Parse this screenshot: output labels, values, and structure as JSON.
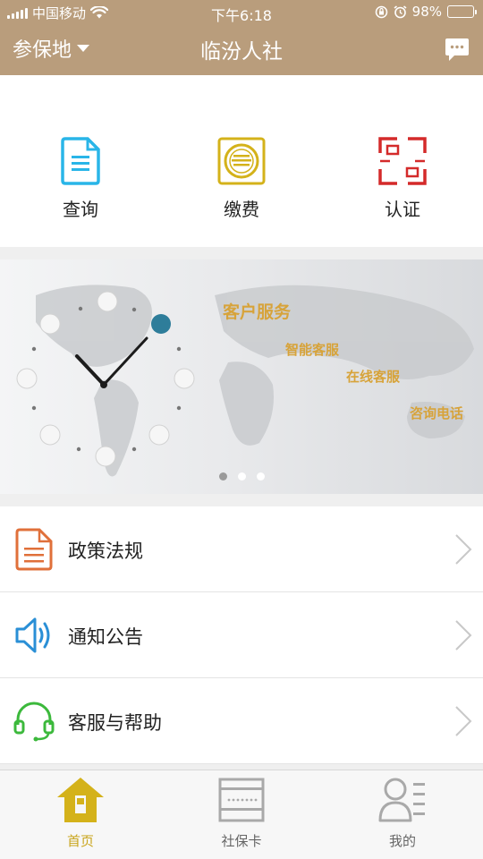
{
  "status_bar": {
    "carrier": "中国移动",
    "time": "下午6:18",
    "battery_text": "98%",
    "battery_level": 0.98,
    "icons": [
      "signal-icon",
      "wifi-icon",
      "orientation-lock-icon",
      "alarm-icon",
      "battery-icon"
    ]
  },
  "nav": {
    "region_label": "参保地",
    "title": "临汾人社",
    "message_icon": "chat-bubble-icon"
  },
  "quick_actions": [
    {
      "label": "查询",
      "icon": "document-query-icon",
      "color": "#29b5e8"
    },
    {
      "label": "缴费",
      "icon": "payment-coin-icon",
      "color": "#d4b21a"
    },
    {
      "label": "认证",
      "icon": "scan-frame-icon",
      "color": "#d42a2a"
    }
  ],
  "banner": {
    "heading": "客户服务",
    "items": [
      "智能客服",
      "在线客服",
      "咨询电话"
    ],
    "page_count": 3,
    "active_page": 1,
    "accent": "#d7a33a"
  },
  "menu": [
    {
      "label": "政策法规",
      "icon": "policy-document-icon",
      "color": "#e0703a"
    },
    {
      "label": "通知公告",
      "icon": "speaker-icon",
      "color": "#2a8fd6"
    },
    {
      "label": "客服与帮助",
      "icon": "headset-icon",
      "color": "#3cb93c"
    }
  ],
  "tabbar": [
    {
      "label": "首页",
      "icon": "home-icon",
      "active": true
    },
    {
      "label": "社保卡",
      "icon": "card-icon",
      "active": false
    },
    {
      "label": "我的",
      "icon": "profile-icon",
      "active": false
    }
  ],
  "colors": {
    "header": "#b99d7c",
    "active_tab": "#c9a51c",
    "inactive_tab": "#a9a9a9"
  }
}
